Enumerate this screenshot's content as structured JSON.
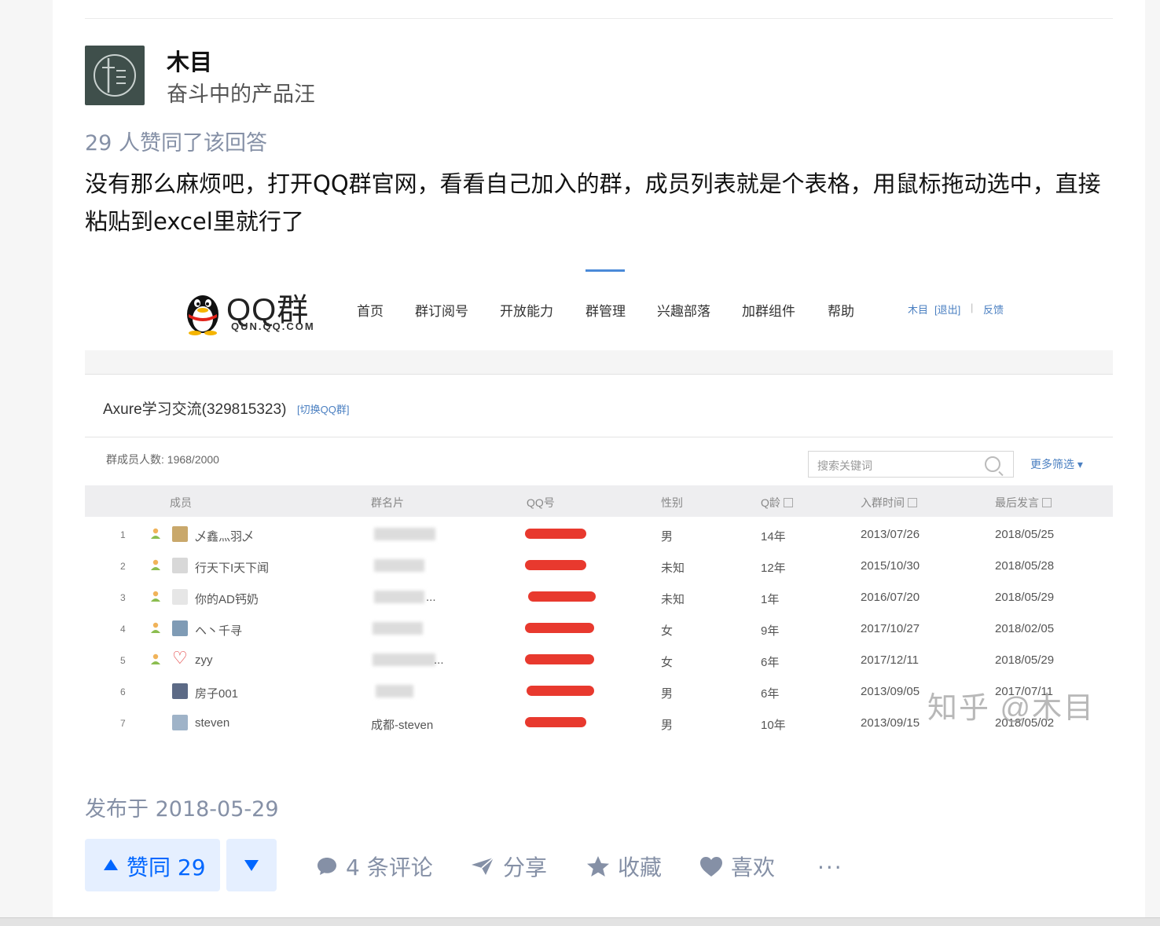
{
  "author": {
    "name": "木目",
    "bio": "奋斗中的产品汪"
  },
  "answer": {
    "votes_text": "29 人赞同了该回答",
    "text": "没有那么麻烦吧，打开QQ群官网，看看自己加入的群，成员列表就是个表格，用鼠标拖动选中，直接粘贴到excel里就行了",
    "publish_text": "发布于 2018-05-29"
  },
  "screenshot": {
    "brand": "QQ群",
    "domain": "QUN.QQ.COM",
    "nav": [
      "首页",
      "群订阅号",
      "开放能力",
      "群管理",
      "兴趣部落",
      "加群组件",
      "帮助"
    ],
    "active_nav": "群管理",
    "user": {
      "name": "木目",
      "logout": "[退出]",
      "sep": "|",
      "feedback": "反馈"
    },
    "group_title": "Axure学习交流(329815323)",
    "switch_group": "[切换QQ群]",
    "member_count": "群成员人数: 1968/2000",
    "search_placeholder": "搜索关键词",
    "more_filter": "更多筛选 ▾",
    "headers": [
      "成员",
      "群名片",
      "QQ号",
      "性别",
      "Q龄",
      "入群时间",
      "最后发言"
    ],
    "rows": [
      {
        "idx": "1",
        "name": "乄鑫灬羽乄",
        "card": "",
        "gender": "男",
        "age": "14年",
        "join": "2013/07/26",
        "last": "2018/05/25"
      },
      {
        "idx": "2",
        "name": "行天下I天下闻",
        "card": "",
        "gender": "未知",
        "age": "12年",
        "join": "2015/10/30",
        "last": "2018/05/28"
      },
      {
        "idx": "3",
        "name": "你的AD钙奶",
        "card": "...",
        "gender": "未知",
        "age": "1年",
        "join": "2016/07/20",
        "last": "2018/05/29"
      },
      {
        "idx": "4",
        "name": "ヘ丶千寻",
        "card": "",
        "gender": "女",
        "age": "9年",
        "join": "2017/10/27",
        "last": "2018/02/05"
      },
      {
        "idx": "5",
        "name": "zyy",
        "card": "...",
        "gender": "女",
        "age": "6年",
        "join": "2017/12/11",
        "last": "2018/05/29"
      },
      {
        "idx": "6",
        "name": "房子001",
        "card": "",
        "gender": "男",
        "age": "6年",
        "join": "2013/09/05",
        "last": "2017/07/11"
      },
      {
        "idx": "7",
        "name": "steven",
        "card": "成都-steven",
        "gender": "男",
        "age": "10年",
        "join": "2013/09/15",
        "last": "2018/05/02"
      }
    ],
    "watermark": "知乎 @木目"
  },
  "actions": {
    "vote_up": "赞同 29",
    "comments": "4 条评论",
    "share": "分享",
    "favorite": "收藏",
    "like": "喜欢",
    "more": "···"
  },
  "colors": {
    "accent": "#0066ff",
    "accent_bg": "#e5efff",
    "meta": "#8590a6",
    "qq_link": "#4a7fc1",
    "redact": "#e8392e"
  }
}
